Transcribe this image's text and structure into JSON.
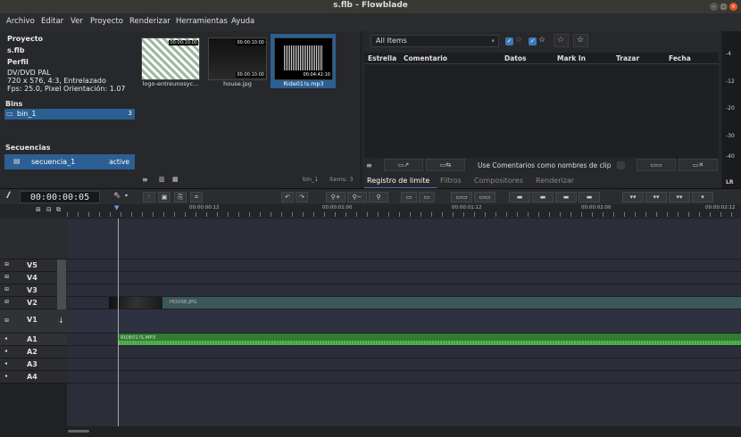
{
  "window": {
    "title": "s.flb - Flowblade"
  },
  "menu": [
    "Archivo",
    "Editar",
    "Ver",
    "Proyecto",
    "Renderizar",
    "Herramientas",
    "Ayuda"
  ],
  "project": {
    "heading": "Proyecto",
    "name": "s.flb",
    "profile_heading": "Perfil",
    "profile_name": "DV/DVD PAL",
    "profile_line1": "720 x 576, 4:3, Entrelazado",
    "profile_line2": "Fps: 25.0, Pixel Orientación: 1.07"
  },
  "bins": {
    "heading": "Bins",
    "items": [
      {
        "label": "bin_1",
        "count": "3"
      }
    ]
  },
  "sequences": {
    "heading": "Secuencias",
    "items": [
      {
        "label": "secuencia_1",
        "status": "active"
      }
    ]
  },
  "media": {
    "items": [
      {
        "label": "logo-entreunosyc...",
        "tc": "00:00:10:00"
      },
      {
        "label": "house.jpg",
        "tc": "00:00:10:00"
      },
      {
        "label": "Ride01!s.mp3",
        "tc": "00:04:42:10"
      }
    ],
    "bin_label": "bin_1",
    "items_label": "items: 3"
  },
  "log": {
    "filter": "All Items",
    "columns": [
      "Estrella",
      "Comentario",
      "Datos",
      "Mark In",
      "Trazar",
      "Fecha"
    ],
    "use_comments_label": "Use Comentarios como nombres de clip"
  },
  "meter": {
    "labels": [
      "-4",
      "-12",
      "-20",
      "-30",
      "-40"
    ],
    "lr": "LR"
  },
  "tabs": [
    "Registro de limite",
    "Filtros",
    "Compositores",
    "Renderizar"
  ],
  "timeline": {
    "timecode": "00:00:00:05",
    "ruler": [
      "00:00:00:12",
      "00:00:01:00",
      "00:00:01:12",
      "00:00:02:00",
      "00:00:02:12"
    ],
    "tracks": [
      {
        "name": "V5"
      },
      {
        "name": "V4"
      },
      {
        "name": "V3"
      },
      {
        "name": "V2"
      },
      {
        "name": "V1"
      },
      {
        "name": "A1"
      },
      {
        "name": "A2"
      },
      {
        "name": "A3"
      },
      {
        "name": "A4"
      }
    ],
    "clips": {
      "video": "HOUSE.JPG",
      "audio": "RIDE01!S.MP3"
    }
  },
  "colors": {
    "selection": "#2c5f93",
    "audio_clip": "#2f7d2f",
    "video_clip": "#3c5a5a"
  }
}
